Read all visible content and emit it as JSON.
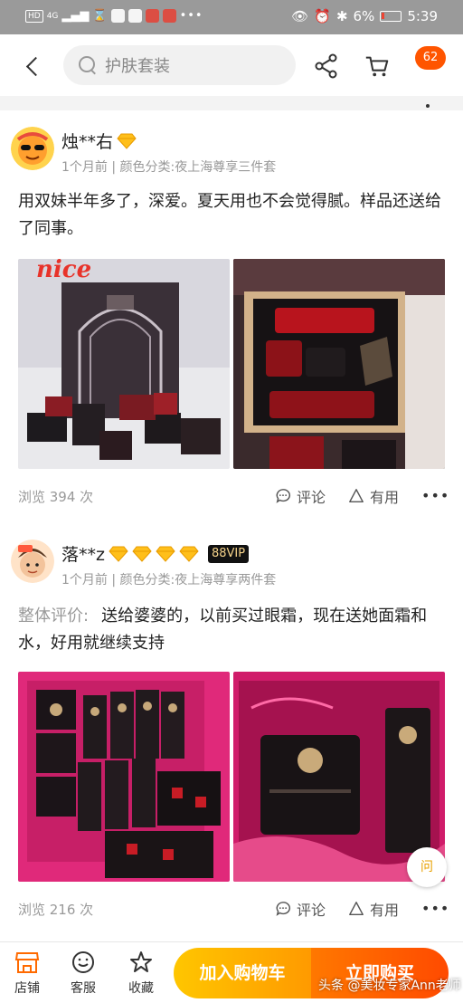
{
  "status_bar": {
    "hd": "HD",
    "signal": "4G",
    "battery": "6%",
    "time": "5:39"
  },
  "header": {
    "search_placeholder": "护肤套装",
    "cart_badge": "62"
  },
  "reviews": [
    {
      "user": "烛**右",
      "diamonds": 1,
      "meta": "1个月前 | 颜色分类:夜上海尊享三件套",
      "content": "用双妹半年多了，深爱。夏天用也不会觉得腻。样品还送给了同事。",
      "photo_text": "nice",
      "views": "浏览 394 次",
      "comment_label": "评论",
      "useful_label": "有用",
      "more": "•••"
    },
    {
      "user": "落**z",
      "diamonds": 4,
      "vip": "88VIP",
      "meta": "1个月前 | 颜色分类:夜上海尊享两件套",
      "content_label": "整体评价:",
      "content": "送给婆婆的，以前买过眼霜，现在送她面霜和水，好用就继续支持",
      "views": "浏览 216 次",
      "comment_label": "评论",
      "useful_label": "有用",
      "more": "•••"
    }
  ],
  "bottom_bar": {
    "shop_label": "店铺",
    "service_label": "客服",
    "favorite_label": "收藏",
    "add_cart_label": "加入购物车",
    "buy_now_label": "立即购买"
  },
  "float_button": "问",
  "watermark": "头条 @美妆专家Ann老师",
  "colors": {
    "accent": "#ff5500",
    "cart_gradient": [
      "#ffc600",
      "#ff9a00"
    ],
    "buy_gradient": [
      "#ff7800",
      "#ff4a00"
    ],
    "vip_gold": "#f6d38a",
    "diamond": "#ffbf1a"
  }
}
